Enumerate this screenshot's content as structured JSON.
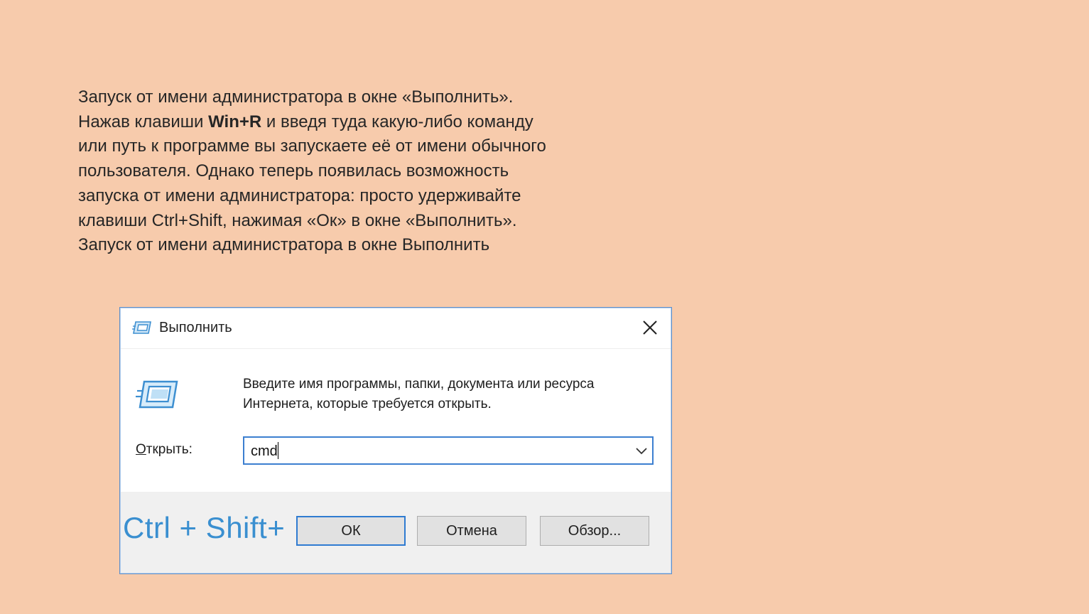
{
  "slide": {
    "line1": "Запуск от имени администратора в окне «Выполнить».",
    "line2_pre": "Нажав клавиши ",
    "line2_bold": "Win+R",
    "line2_post": " и введя туда какую-либо команду",
    "line3": "или путь к программе вы запускаете её от имени обычного",
    "line4": "пользователя. Однако теперь появилась возможность",
    "line5": "запуска от имени администратора: просто удерживайте",
    "line6": "клавиши Ctrl+Shift, нажимая «Ок» в окне «Выполнить».",
    "line7": "Запуск от имени администратора в окне Выполнить"
  },
  "dialog": {
    "title": "Выполнить",
    "description_line1": "Введите имя программы, папки, документа или ресурса",
    "description_line2": "Интернета, которые требуется открыть.",
    "open_label_underlined": "О",
    "open_label_rest": "ткрыть:",
    "command_value": "cmd",
    "hotkey_overlay": "Ctrl + Shift+",
    "ok_label": "ОК",
    "cancel_label": "Отмена",
    "browse_label": "Обзор..."
  },
  "colors": {
    "background": "#f7cbac",
    "accent": "#2f7bd1",
    "hotkey_text": "#3a8fd0"
  },
  "icons": [
    "run-icon",
    "close-icon",
    "chevron-down-icon"
  ]
}
